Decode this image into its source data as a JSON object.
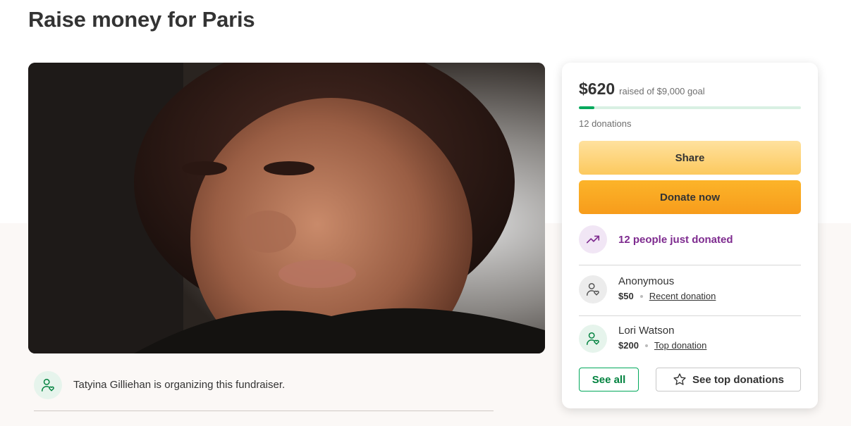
{
  "page": {
    "title": "Raise money for Paris"
  },
  "hero": {
    "alt": "Photo of Paris",
    "icon": "photo-portrait"
  },
  "organizer": {
    "text": "Tatyina Gilliehan is organizing this fundraiser.",
    "icon": "person-heart-icon"
  },
  "donation_card": {
    "raised_amount": "$620",
    "goal_text": "raised of $9,000 goal",
    "progress_fraction": 0.069,
    "donations_count": "12 donations",
    "share_label": "Share",
    "donate_label": "Donate now",
    "trend": {
      "icon": "trending-up-icon",
      "text": "12 people just donated"
    },
    "donors": [
      {
        "name": "Anonymous",
        "amount": "$50",
        "tag": "Recent donation"
      },
      {
        "name": "Lori Watson",
        "amount": "$200",
        "tag": "Top donation"
      }
    ],
    "see_all_label": "See all",
    "see_top_label": "See top donations"
  },
  "colors": {
    "brand_green": "#02a95c",
    "share_yellow": "#fcc95e",
    "donate_orange": "#f79c1b",
    "trend_purple": "#7e2b8f"
  }
}
